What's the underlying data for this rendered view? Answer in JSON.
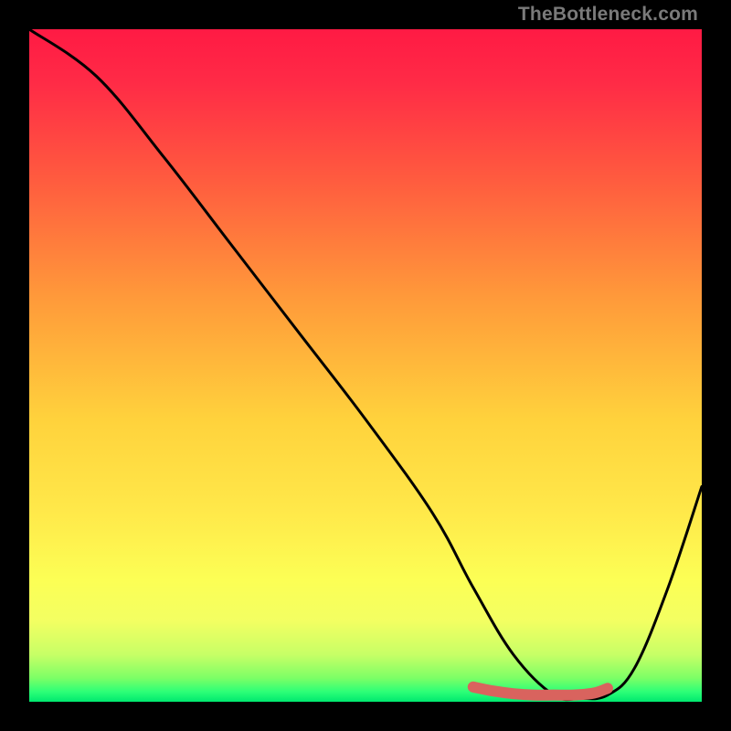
{
  "watermark": "TheBottleneck.com",
  "chart_data": {
    "type": "line",
    "title": "",
    "xlabel": "",
    "ylabel": "",
    "xlim": [
      0,
      100
    ],
    "ylim": [
      0,
      100
    ],
    "grid": false,
    "legend": false,
    "series": [
      {
        "name": "main-curve",
        "x": [
          0,
          10,
          20,
          30,
          40,
          50,
          60,
          66,
          72,
          78,
          82,
          86,
          90,
          95,
          100
        ],
        "y": [
          100,
          93,
          81,
          68,
          55,
          42,
          28,
          17,
          7,
          1,
          0.5,
          1,
          5,
          17,
          32
        ]
      },
      {
        "name": "bottom-highlight",
        "x": [
          66,
          69,
          72,
          75,
          78,
          81,
          84,
          86
        ],
        "y": [
          2.2,
          1.6,
          1.2,
          1.0,
          1.0,
          1.0,
          1.3,
          2.0
        ]
      }
    ],
    "gradient_stops": [
      {
        "offset": 0.0,
        "color": "#ff1a44"
      },
      {
        "offset": 0.08,
        "color": "#ff2b46"
      },
      {
        "offset": 0.22,
        "color": "#ff5a3f"
      },
      {
        "offset": 0.4,
        "color": "#ff9a3a"
      },
      {
        "offset": 0.58,
        "color": "#ffd23c"
      },
      {
        "offset": 0.72,
        "color": "#ffe94a"
      },
      {
        "offset": 0.82,
        "color": "#fcff55"
      },
      {
        "offset": 0.88,
        "color": "#f3ff62"
      },
      {
        "offset": 0.93,
        "color": "#c7ff66"
      },
      {
        "offset": 0.965,
        "color": "#7cff66"
      },
      {
        "offset": 0.985,
        "color": "#2dff77"
      },
      {
        "offset": 1.0,
        "color": "#00e86f"
      }
    ],
    "highlight_color": "#d9635e"
  }
}
